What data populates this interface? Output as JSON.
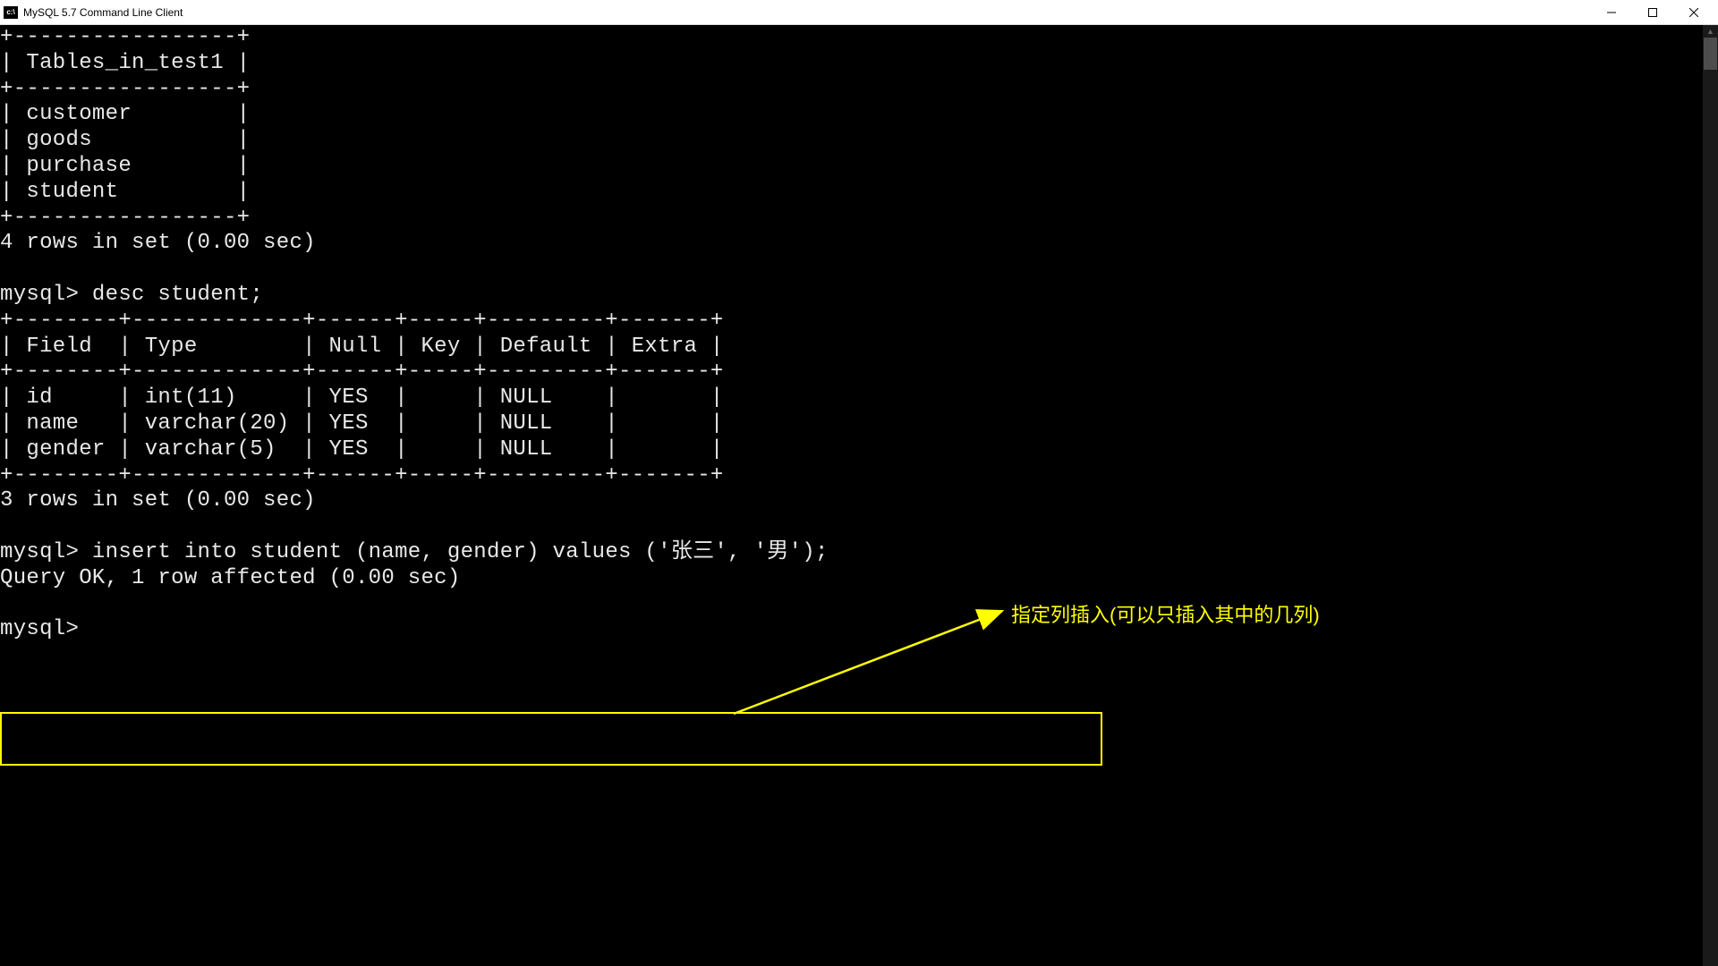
{
  "window": {
    "title": "MySQL 5.7 Command Line Client",
    "icon_label": "cmd"
  },
  "tables_output": {
    "border_top": "+-----------------+",
    "header": "| Tables_in_test1 |",
    "border_mid": "+-----------------+",
    "rows": [
      "| customer        |",
      "| goods           |",
      "| purchase        |",
      "| student         |"
    ],
    "border_bottom": "+-----------------+",
    "summary": "4 rows in set (0.00 sec)"
  },
  "desc_cmd": {
    "prompt": "mysql> ",
    "command": "desc student;"
  },
  "desc_output": {
    "border_top": "+--------+-------------+------+-----+---------+-------+",
    "header": "| Field  | Type        | Null | Key | Default | Extra |",
    "border_mid": "+--------+-------------+------+-----+---------+-------+",
    "rows": [
      "| id     | int(11)     | YES  |     | NULL    |       |",
      "| name   | varchar(20) | YES  |     | NULL    |       |",
      "| gender | varchar(5)  | YES  |     | NULL    |       |"
    ],
    "border_bottom": "+--------+-------------+------+-----+---------+-------+",
    "summary": "3 rows in set (0.00 sec)"
  },
  "insert_cmd": {
    "prompt": "mysql> ",
    "command": "insert into student (name, gender) values ('张三', '男');",
    "result": "Query OK, 1 row affected (0.00 sec)"
  },
  "final_prompt": "mysql> ",
  "annotation": {
    "text": "指定列插入(可以只插入其中的几列)"
  },
  "chart_data": {
    "type": "table",
    "tables": [
      {
        "name": "show_tables_result",
        "columns": [
          "Tables_in_test1"
        ],
        "rows": [
          [
            "customer"
          ],
          [
            "goods"
          ],
          [
            "purchase"
          ],
          [
            "student"
          ]
        ],
        "summary": "4 rows in set (0.00 sec)"
      },
      {
        "name": "desc_student_result",
        "columns": [
          "Field",
          "Type",
          "Null",
          "Key",
          "Default",
          "Extra"
        ],
        "rows": [
          [
            "id",
            "int(11)",
            "YES",
            "",
            "NULL",
            ""
          ],
          [
            "name",
            "varchar(20)",
            "YES",
            "",
            "NULL",
            ""
          ],
          [
            "gender",
            "varchar(5)",
            "YES",
            "",
            "NULL",
            ""
          ]
        ],
        "summary": "3 rows in set (0.00 sec)"
      }
    ],
    "commands": [
      "desc student;",
      "insert into student (name, gender) values ('张三', '男');"
    ],
    "insert_result": "Query OK, 1 row affected (0.00 sec)"
  }
}
